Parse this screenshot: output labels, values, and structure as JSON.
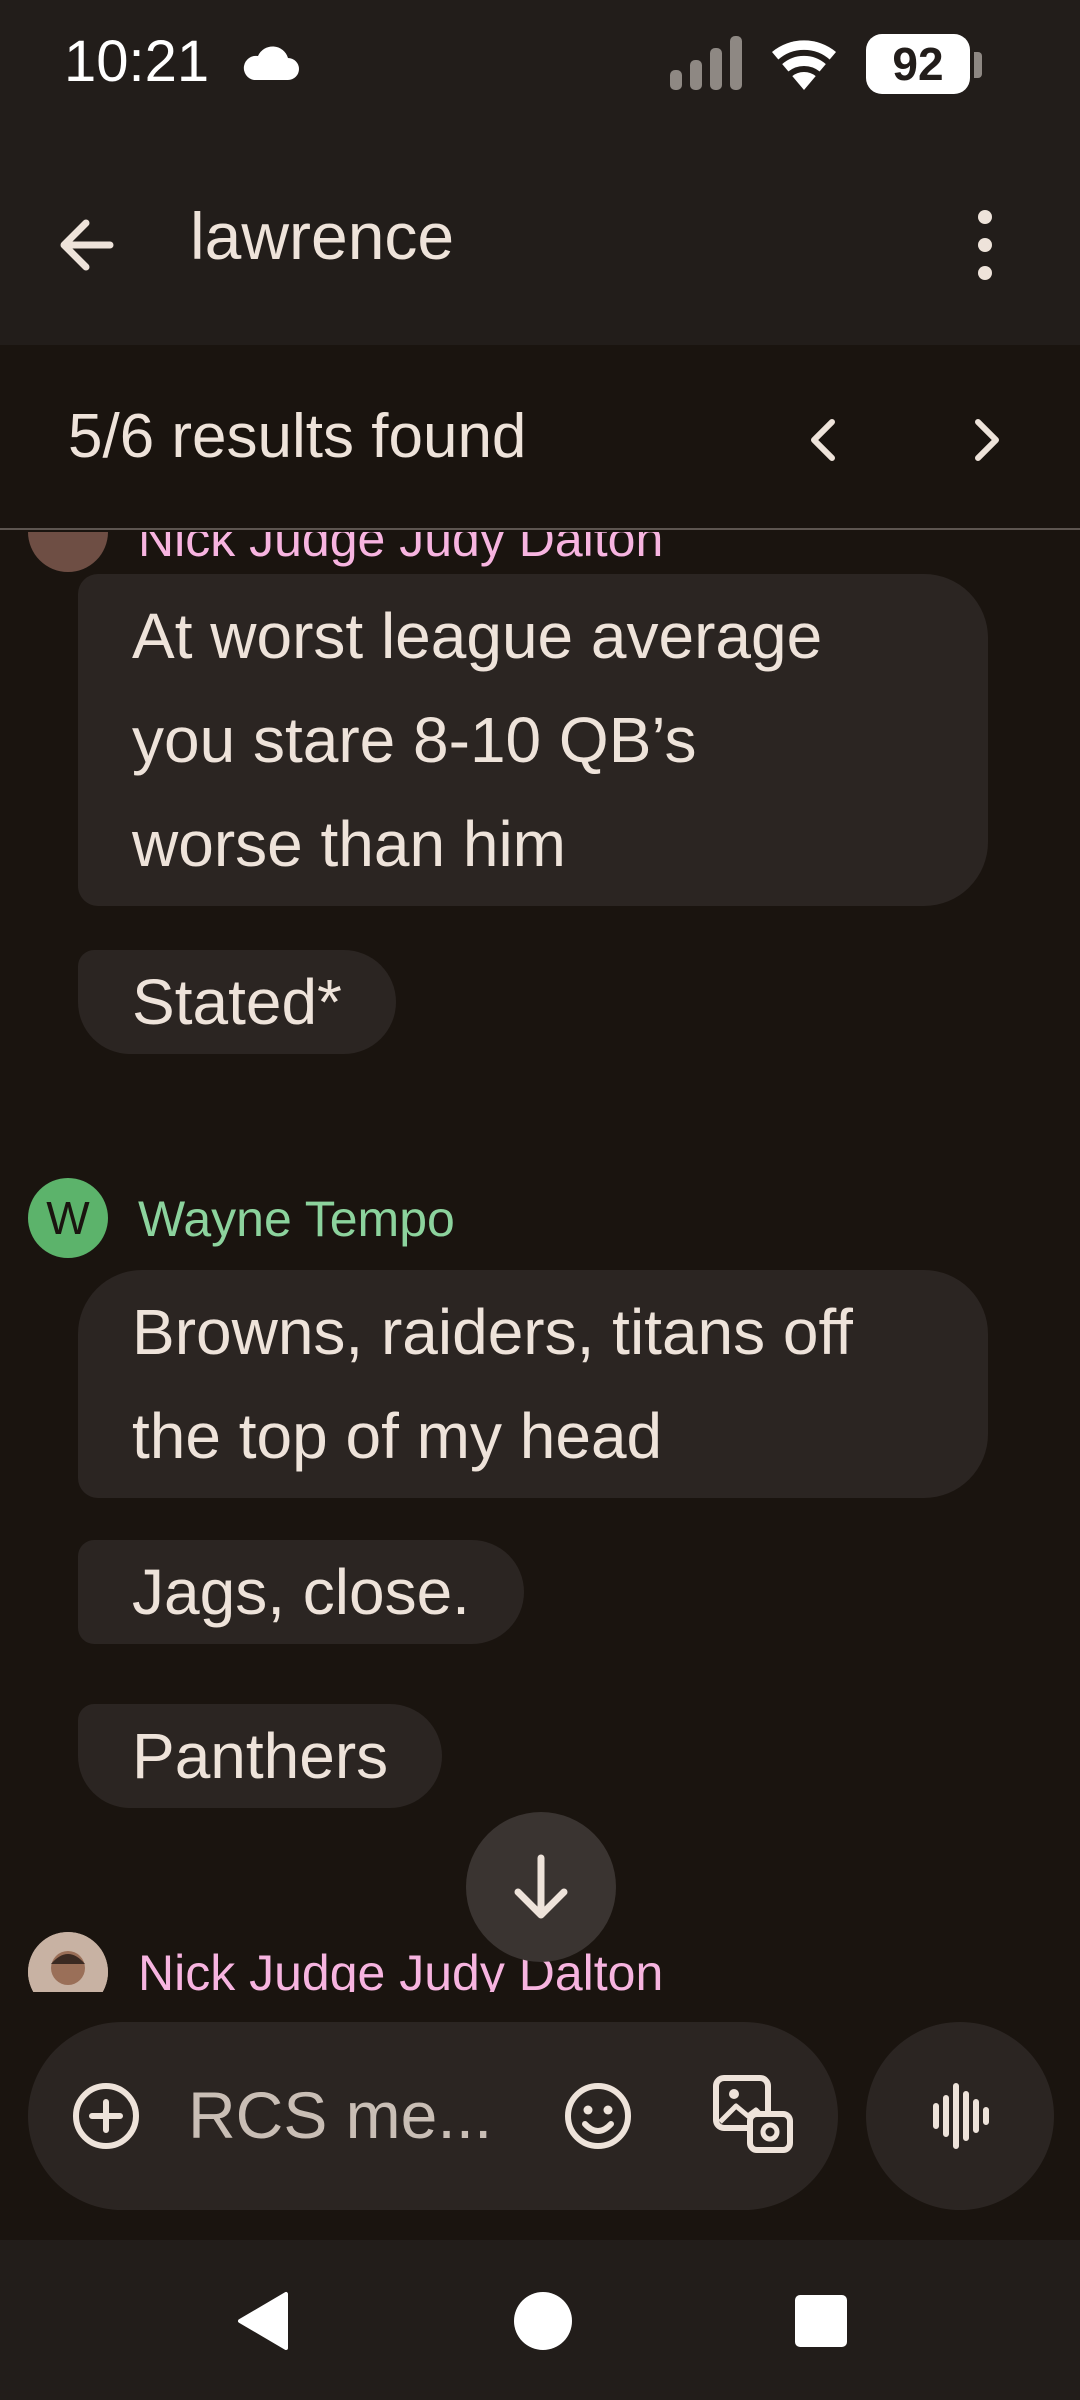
{
  "status_bar": {
    "time": "10:21",
    "battery": "92"
  },
  "app_bar": {
    "search_term": "lawrence"
  },
  "results": {
    "text": "5/6 results found"
  },
  "messages": [
    {
      "type": "sender",
      "name": "Nick Judge Judy Dalton",
      "color": "#f7b4e0"
    },
    {
      "type": "bubble",
      "text": [
        "At worst league average",
        "you stare 8-10 QB’s",
        "worse than him"
      ]
    },
    {
      "type": "bubble",
      "text": "Stated*"
    },
    {
      "type": "sender",
      "name": "Wayne Tempo",
      "avatar_letter": "W",
      "color": "#8cd39d"
    },
    {
      "type": "bubble",
      "text": [
        "Browns, raiders, titans off",
        "the top of my head"
      ]
    },
    {
      "type": "bubble",
      "text": "Jags, close."
    },
    {
      "type": "bubble",
      "text": "Panthers"
    },
    {
      "type": "sender",
      "name": "Nick Judge Judy Dalton",
      "color": "#f7b4e0"
    }
  ],
  "composer": {
    "placeholder": "RCS me..."
  },
  "icons": {
    "status": [
      "cloud-icon",
      "signal-icon",
      "wifi-icon",
      "battery-icon"
    ],
    "app_bar": [
      "back-arrow-icon",
      "more-vert-icon"
    ],
    "results": [
      "chevron-left-icon",
      "chevron-right-icon"
    ],
    "composer": [
      "add-circle-icon",
      "emoji-icon",
      "gallery-icon",
      "voice-waveform-icon"
    ],
    "chat": [
      "arrow-down-icon"
    ],
    "nav": [
      "nav-back-icon",
      "nav-home-icon",
      "nav-recents-icon"
    ]
  },
  "colors": {
    "background": "#1a140f",
    "bar": "#221d1a",
    "bubble": "#2b2522",
    "sender_pink": "#f7b4e0",
    "sender_green": "#8cd39d",
    "avatar_green": "#5cb36b"
  }
}
